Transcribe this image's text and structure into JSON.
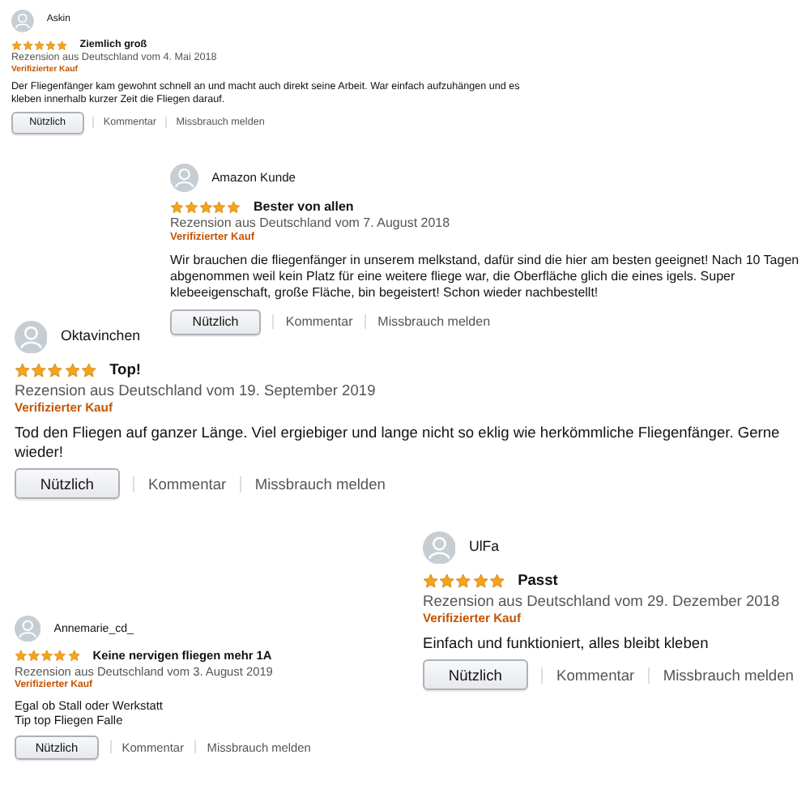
{
  "reviews": [
    {
      "author": "Askin",
      "stars": 5,
      "title": "Ziemlich groß",
      "date": "Rezension aus Deutschland vom 4. Mai 2018",
      "verified": "Verifizierter Kauf",
      "text": "Der Fliegenfänger kam gewohnt schnell an und macht auch direkt seine Arbeit. War einfach aufzuhängen und es kleben innerhalb kurzer Zeit die Fliegen darauf.",
      "helpful": "Nützlich",
      "comment": "Kommentar",
      "report": "Missbrauch melden"
    },
    {
      "author": "Amazon Kunde",
      "stars": 5,
      "title": "Bester von allen",
      "date": "Rezension aus Deutschland vom 7. August 2018",
      "verified": "Verifizierter Kauf",
      "text": "Wir brauchen die fliegenfänger in unserem melkstand, dafür sind die hier am besten geeignet! Nach 10 Tagen abgenommen weil kein Platz für eine weitere fliege war, die Oberfläche glich die eines igels. Super klebeeigenschaft, große Fläche, bin begeistert! Schon wieder nachbestellt!",
      "helpful": "Nützlich",
      "comment": "Kommentar",
      "report": "Missbrauch melden"
    },
    {
      "author": "Oktavinchen",
      "stars": 5,
      "title": "Top!",
      "date": "Rezension aus Deutschland vom 19. September 2019",
      "verified": "Verifizierter Kauf",
      "text": "Tod den Fliegen auf ganzer Länge. Viel ergiebiger und lange nicht so eklig wie herkömmliche Fliegenfänger. Gerne wieder!",
      "helpful": "Nützlich",
      "comment": "Kommentar",
      "report": "Missbrauch melden"
    },
    {
      "author": "UlFa",
      "stars": 5,
      "title": "Passt",
      "date": "Rezension aus Deutschland vom 29. Dezember 2018",
      "verified": "Verifizierter Kauf",
      "text": "Einfach und funktioniert, alles bleibt kleben",
      "helpful": "Nützlich",
      "comment": "Kommentar",
      "report": "Missbrauch melden"
    },
    {
      "author": "Annemarie_cd_",
      "stars": 5,
      "title": "Keine nervigen fliegen mehr 1A",
      "date": "Rezension aus Deutschland vom 3. August 2019",
      "verified": "Verifizierter Kauf",
      "text": "Egal ob Stall oder Werkstatt\nTip top Fliegen Falle",
      "helpful": "Nützlich",
      "comment": "Kommentar",
      "report": "Missbrauch melden"
    }
  ]
}
